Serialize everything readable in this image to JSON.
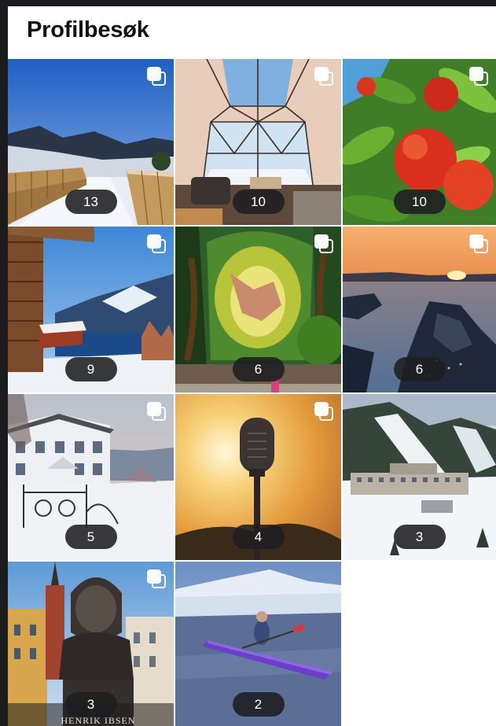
{
  "header": {
    "title": "Profilbesøk"
  },
  "posts": [
    {
      "subject": "wooden boardwalk over snowy fjord",
      "views": "13",
      "multiple": true
    },
    {
      "subject": "geodesic glamping dome with window view",
      "views": "10",
      "multiple": true
    },
    {
      "subject": "red apples on tree",
      "views": "10",
      "multiple": true
    },
    {
      "subject": "log cabin overlooking fjord",
      "views": "9",
      "multiple": true
    },
    {
      "subject": "forest mural on building wall",
      "views": "6",
      "multiple": true
    },
    {
      "subject": "aerial fjord islands at sunset",
      "views": "6",
      "multiple": true
    },
    {
      "subject": "white house in winter",
      "views": "5",
      "multiple": true
    },
    {
      "subject": "vintage microphone sculpture at sunset",
      "views": "4",
      "multiple": true
    },
    {
      "subject": "ski resort hotel in snowy valley",
      "views": "3",
      "multiple": false
    },
    {
      "subject": "Henrik Ibsen bust statue",
      "views": "3",
      "multiple": true,
      "engraving": "HENRIK IBSEN"
    },
    {
      "subject": "kayaker on winter lake",
      "views": "2",
      "multiple": false
    }
  ],
  "icons": {
    "multiple_posts": "carousel-icon"
  }
}
